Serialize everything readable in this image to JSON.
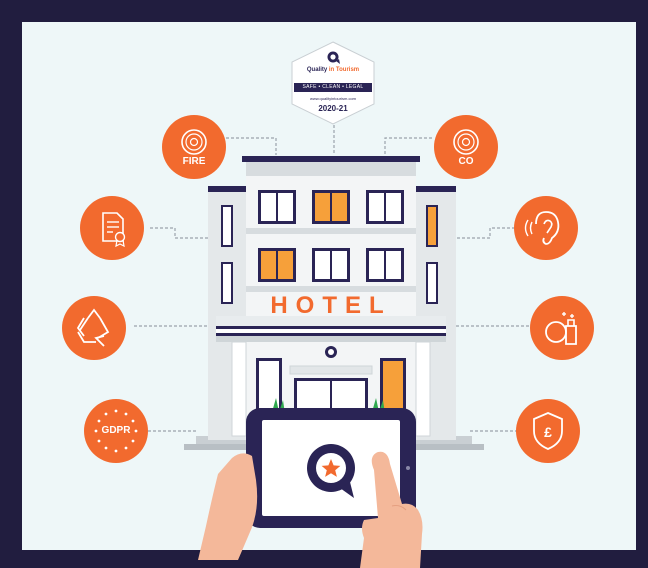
{
  "badge": {
    "brand_prefix": "Quality",
    "brand_highlight": "in Tourism",
    "tagline": "SAFE • CLEAN • LEGAL",
    "url": "www.qualityintourism.com",
    "year": "2020-21"
  },
  "hotel_sign": "HOTEL",
  "icons": {
    "fire": {
      "label": "FIRE"
    },
    "co": {
      "label": "CO"
    },
    "gdpr": {
      "label": "GDPR"
    }
  },
  "colors": {
    "accent": "#f26a2e",
    "frame": "#211d3f",
    "panel": "#eef7f8",
    "navy": "#2a2455",
    "window_lit": "#f6a03a"
  }
}
